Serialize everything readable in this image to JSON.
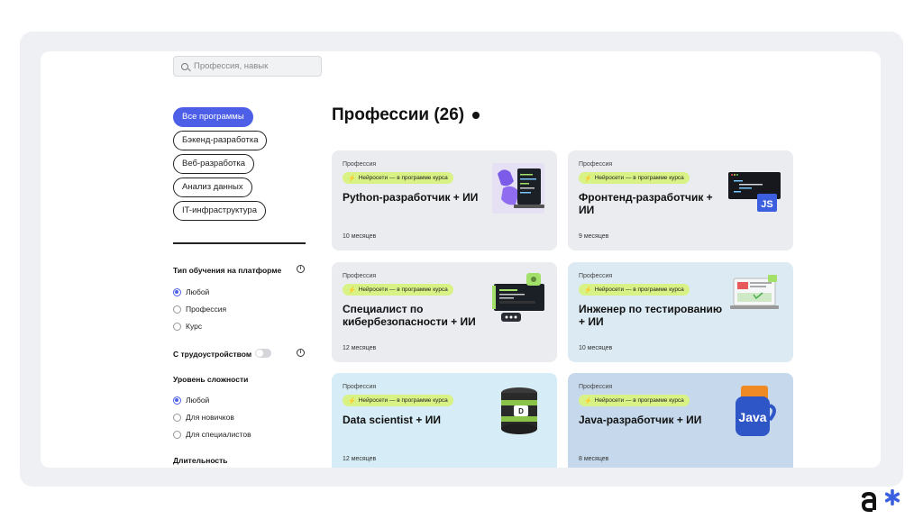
{
  "search": {
    "placeholder": "Профессия, навык"
  },
  "categories": [
    {
      "label": "Все программы",
      "active": true
    },
    {
      "label": "Бэкенд-разработка",
      "active": false
    },
    {
      "label": "Веб-разработка",
      "active": false
    },
    {
      "label": "Анализ данных",
      "active": false
    },
    {
      "label": "IT-инфраструктура",
      "active": false
    }
  ],
  "filters": {
    "learning_type": {
      "title": "Тип обучения на платформе",
      "options": [
        {
          "label": "Любой",
          "selected": true
        },
        {
          "label": "Профессия",
          "selected": false
        },
        {
          "label": "Курс",
          "selected": false
        }
      ]
    },
    "employment": {
      "label": "С трудоустройством",
      "enabled": false
    },
    "level": {
      "title": "Уровень сложности",
      "options": [
        {
          "label": "Любой",
          "selected": true
        },
        {
          "label": "Для новичков",
          "selected": false
        },
        {
          "label": "Для специалистов",
          "selected": false
        }
      ]
    },
    "duration": {
      "title": "Длительность"
    }
  },
  "main": {
    "heading": "Профессии (26)",
    "cards": [
      {
        "kind": "Профессия",
        "badge": "Нейросети — в программе курса",
        "title": "Python-разработчик + ИИ",
        "duration": "10 месяцев",
        "bg": "#ebecf0",
        "icon": "python-laptop-icon"
      },
      {
        "kind": "Профессия",
        "badge": "Нейросети — в программе курса",
        "title": "Фронтенд-разработчик + ИИ",
        "duration": "9 месяцев",
        "bg": "#ebecf0",
        "icon": "js-code-window-icon"
      },
      {
        "kind": "Профессия",
        "badge": "Нейросети — в программе курса",
        "title": "Специалист по кибербезопасности + ИИ",
        "duration": "12 месяцев",
        "bg": "#ebecf0",
        "icon": "security-terminal-icon"
      },
      {
        "kind": "Профессия",
        "badge": "Нейросети — в программе курса",
        "title": "Инженер по тестированию + ИИ",
        "duration": "10 месяцев",
        "bg": "#dcebf3",
        "icon": "testing-laptop-icon"
      },
      {
        "kind": "Профессия",
        "badge": "Нейросети — в программе курса",
        "title": "Data scientist + ИИ",
        "duration": "12 месяцев",
        "bg": "#d6ecf6",
        "icon": "data-jar-icon"
      },
      {
        "kind": "Профессия",
        "badge": "Нейросети — в программе курса",
        "title": "Java-разработчик + ИИ",
        "duration": "8 месяцев",
        "bg": "#c6d9ec",
        "icon": "java-cup-icon"
      }
    ]
  },
  "colors": {
    "accent": "#4c5fe6",
    "badge": "#d9f285"
  }
}
